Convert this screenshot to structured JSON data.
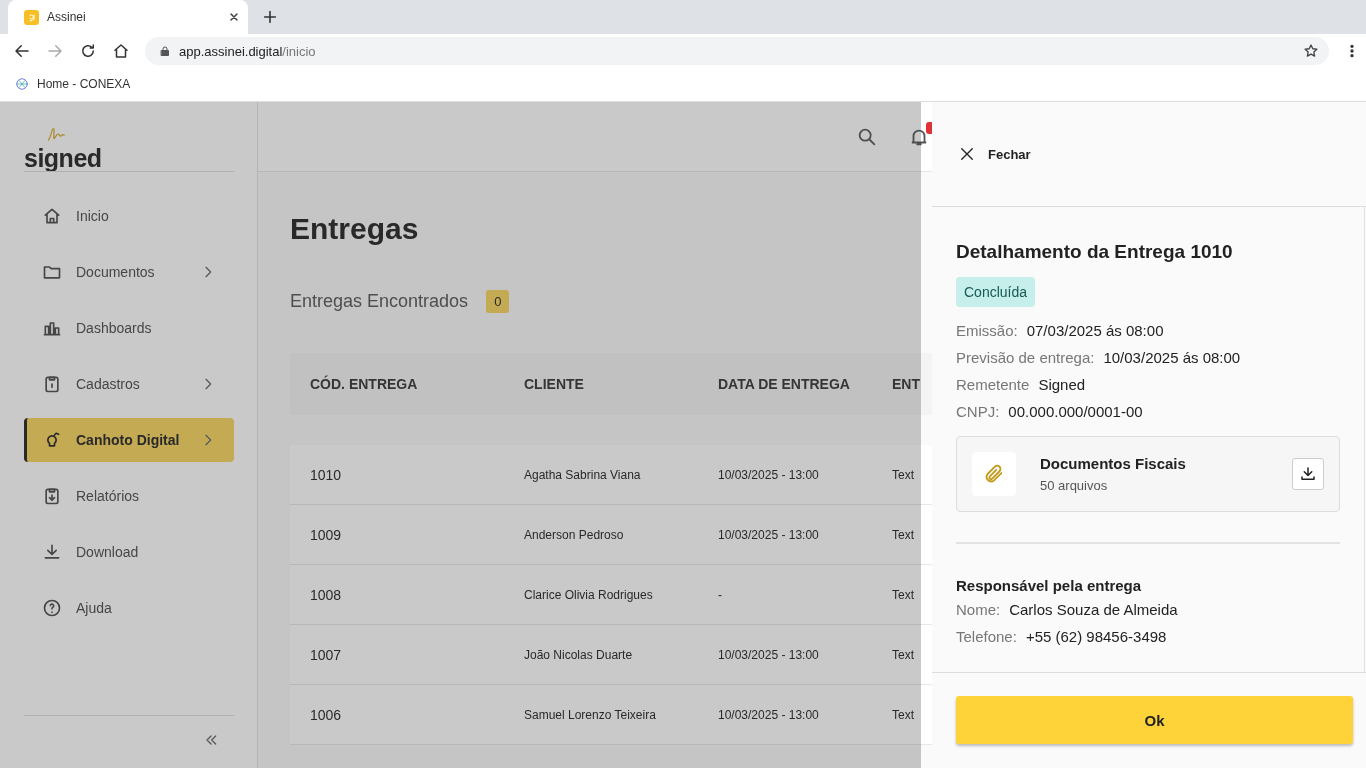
{
  "browser": {
    "tab": {
      "title": "Assinei",
      "selected": true
    },
    "url_host": "app.assinei.digital",
    "url_path": "/inicio",
    "bookmarks": [
      "Home - CONEXA"
    ]
  },
  "sidebar": {
    "logo": "signed",
    "items": [
      {
        "label": "Inicio",
        "selected": false,
        "submenu": false
      },
      {
        "label": "Documentos",
        "selected": false,
        "submenu": true
      },
      {
        "label": "Dashboards",
        "selected": false,
        "submenu": false
      },
      {
        "label": "Cadastros",
        "selected": false,
        "submenu": true
      },
      {
        "label": "Canhoto Digital",
        "selected": true,
        "submenu": true
      },
      {
        "label": "Relatórios",
        "selected": false,
        "submenu": false
      },
      {
        "label": "Download",
        "selected": false,
        "submenu": false
      },
      {
        "label": "Ajuda",
        "selected": false,
        "submenu": false
      }
    ]
  },
  "main": {
    "title": "Entregas",
    "found_label": "Entregas Encontrados",
    "found_count": "0",
    "table": {
      "columns": [
        "CÓD. ENTREGA",
        "CLIENTE",
        "DATA DE ENTREGA",
        "ENT"
      ],
      "rows": [
        [
          "1010",
          "Agatha Sabrina Viana",
          "10/03/2025 - 13:00",
          "Text"
        ],
        [
          "1009",
          "Anderson Pedroso",
          "10/03/2025 - 13:00",
          "Text"
        ],
        [
          "1008",
          "Clarice Olivia Rodrigues",
          "-",
          "Text"
        ],
        [
          "1007",
          "João Nicolas Duarte",
          "10/03/2025 - 13:00",
          "Text"
        ],
        [
          "1006",
          "Samuel Lorenzo Teixeira",
          "10/03/2025 - 13:00",
          "Text"
        ]
      ]
    }
  },
  "panel": {
    "close_label": "Fechar",
    "title": "Detalhamento da Entrega 1010",
    "status": "Concluída",
    "fields": [
      {
        "label": "Emissão:",
        "value": "07/03/2025 ás 08:00"
      },
      {
        "label": "Previsão de entrega:",
        "value": "10/03/2025 ás 08:00"
      },
      {
        "label": "Remetente",
        "value": "Signed"
      },
      {
        "label": "CNPJ:",
        "value": "00.000.000/0001-00"
      }
    ],
    "attachment": {
      "title": "Documentos Fiscais",
      "subtitle": "50 arquivos"
    },
    "responsible": {
      "title": "Responsável pela entrega",
      "fields": [
        {
          "label": "Nome:",
          "value": "Carlos Souza de Almeida"
        },
        {
          "label": "Telefone:",
          "value": "+55 (62) 98456-3498"
        }
      ]
    },
    "button": "Ok"
  }
}
